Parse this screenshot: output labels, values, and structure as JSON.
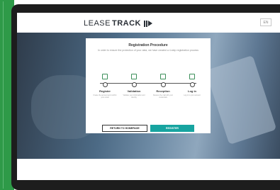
{
  "header": {
    "logo_light": "LEASE",
    "logo_bold": "TRACK",
    "language": "EN"
  },
  "modal": {
    "title": "Registration Procedure",
    "intro": "In order to ensure the protection of your data, we have created a 4-step registration process",
    "steps": [
      {
        "icon": "document-icon",
        "label": "Register",
        "desc": "Create the account and confirm your email"
      },
      {
        "icon": "edit-document-icon",
        "label": "Validation",
        "desc": "Validate your information and identity"
      },
      {
        "icon": "mail-icon",
        "label": "Reception",
        "desc": "Receive the mail with your credentials"
      },
      {
        "icon": "monitor-icon",
        "label": "Log in",
        "desc": "Log in to your account"
      }
    ],
    "return_label": "RETURN TO HOMEPAGE",
    "register_label": "REGISTER"
  },
  "colors": {
    "accent": "#17a4a0",
    "frame": "#2e9a48"
  }
}
